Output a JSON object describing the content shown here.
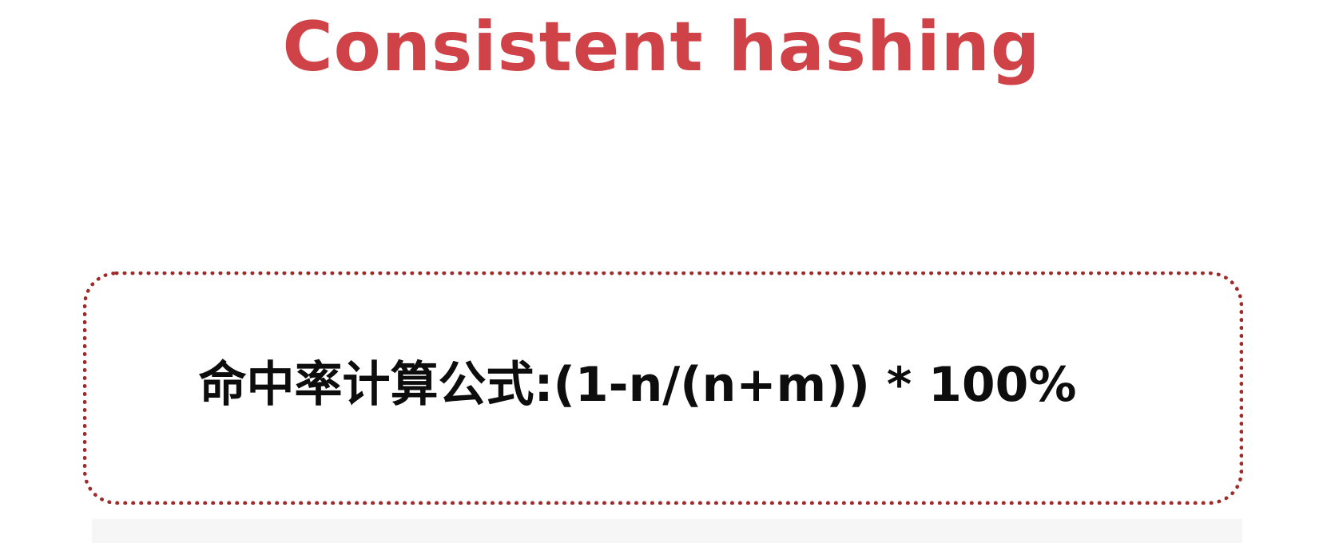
{
  "slide": {
    "title": "Consistent hashing",
    "formula": "命中率计算公式:(1-n/(n+m)) * 100%"
  },
  "colors": {
    "title": "#cf4348",
    "box_border": "#9e2a2a",
    "text": "#0d0d0d",
    "background": "#ffffff"
  }
}
